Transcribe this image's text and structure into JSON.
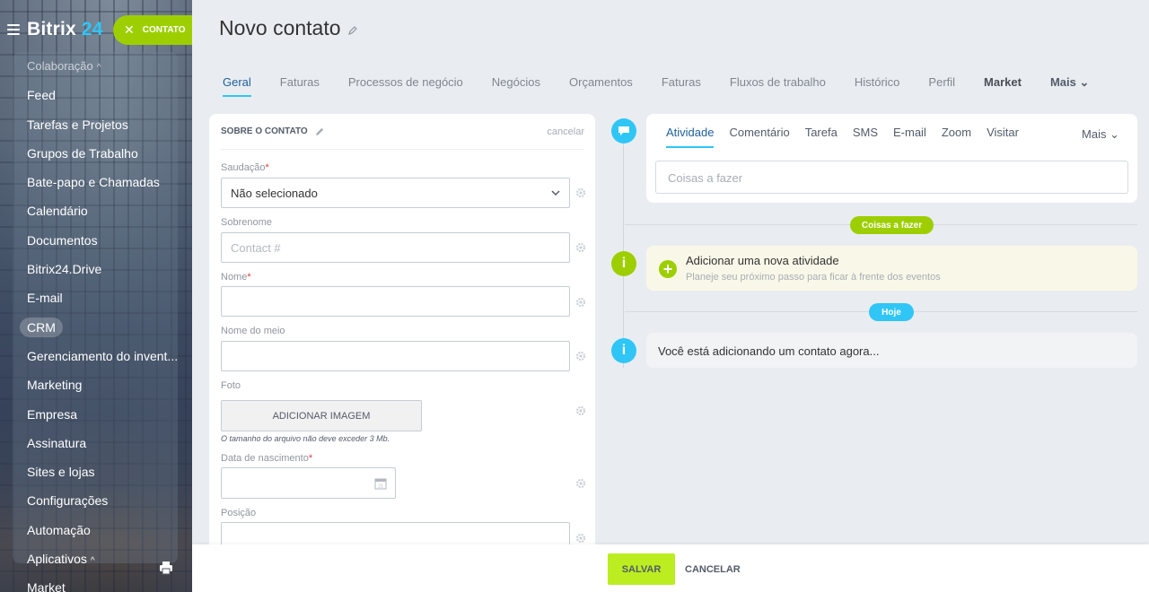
{
  "sidebar": {
    "logo": "Bitrix",
    "logo_num": "24",
    "contact_button": "CONTATO",
    "items": [
      {
        "label": "Colaboração",
        "muted": true,
        "chevron": "^"
      },
      {
        "label": "Feed"
      },
      {
        "label": "Tarefas e Projetos"
      },
      {
        "label": "Grupos de Trabalho"
      },
      {
        "label": "Bate-papo e Chamadas"
      },
      {
        "label": "Calendário"
      },
      {
        "label": "Documentos"
      },
      {
        "label": "Bitrix24.Drive"
      },
      {
        "label": "E-mail"
      },
      {
        "label": "CRM",
        "active": true
      },
      {
        "label": "Gerenciamento do invent..."
      },
      {
        "label": "Marketing"
      },
      {
        "label": "Empresa"
      },
      {
        "label": "Assinatura"
      },
      {
        "label": "Sites e lojas"
      },
      {
        "label": "Configurações"
      },
      {
        "label": "Automação"
      },
      {
        "label": "Aplicativos",
        "chevron": "^"
      },
      {
        "label": "Market"
      }
    ]
  },
  "header": {
    "title": "Novo contato",
    "tabs": [
      {
        "label": "Geral",
        "active": true
      },
      {
        "label": "Faturas"
      },
      {
        "label": "Processos de negócio"
      },
      {
        "label": "Negócios"
      },
      {
        "label": "Orçamentos"
      },
      {
        "label": "Faturas"
      },
      {
        "label": "Fluxos de trabalho"
      },
      {
        "label": "Histórico"
      },
      {
        "label": "Perfil"
      },
      {
        "label": "Market",
        "bold": true
      },
      {
        "label": "Mais",
        "more": true
      }
    ]
  },
  "form": {
    "section_title": "SOBRE O CONTATO",
    "cancel": "cancelar",
    "salutation_label": "Saudação",
    "salutation_value": "Não selecionado",
    "surname_label": "Sobrenome",
    "surname_placeholder": "Contact #",
    "name_label": "Nome",
    "middle_name_label": "Nome do meio",
    "photo_label": "Foto",
    "add_image": "ADICIONAR IMAGEM",
    "photo_note": "O tamanho do arquivo não deve exceder 3 Mb.",
    "birthdate_label": "Data de nascimento",
    "position_label": "Posição",
    "required_mark": "*"
  },
  "activity": {
    "tabs": [
      "Atividade",
      "Comentário",
      "Tarefa",
      "SMS",
      "E-mail",
      "Zoom",
      "Visitar"
    ],
    "more": "Mais",
    "todo_placeholder": "Coisas a fazer",
    "todo_badge": "Coisas a fazer",
    "new_activity_title": "Adicionar uma nova atividade",
    "new_activity_subtitle": "Planeje seu próximo passo para ficar à frente dos eventos",
    "today_badge": "Hoje",
    "adding_text": "Você está adicionando um contato agora..."
  },
  "footer": {
    "save": "SALVAR",
    "cancel": "CANCELAR"
  },
  "colors": {
    "accent_green": "#9dcf00",
    "accent_blue": "#2fc6f6",
    "save_green": "#bbed21"
  }
}
